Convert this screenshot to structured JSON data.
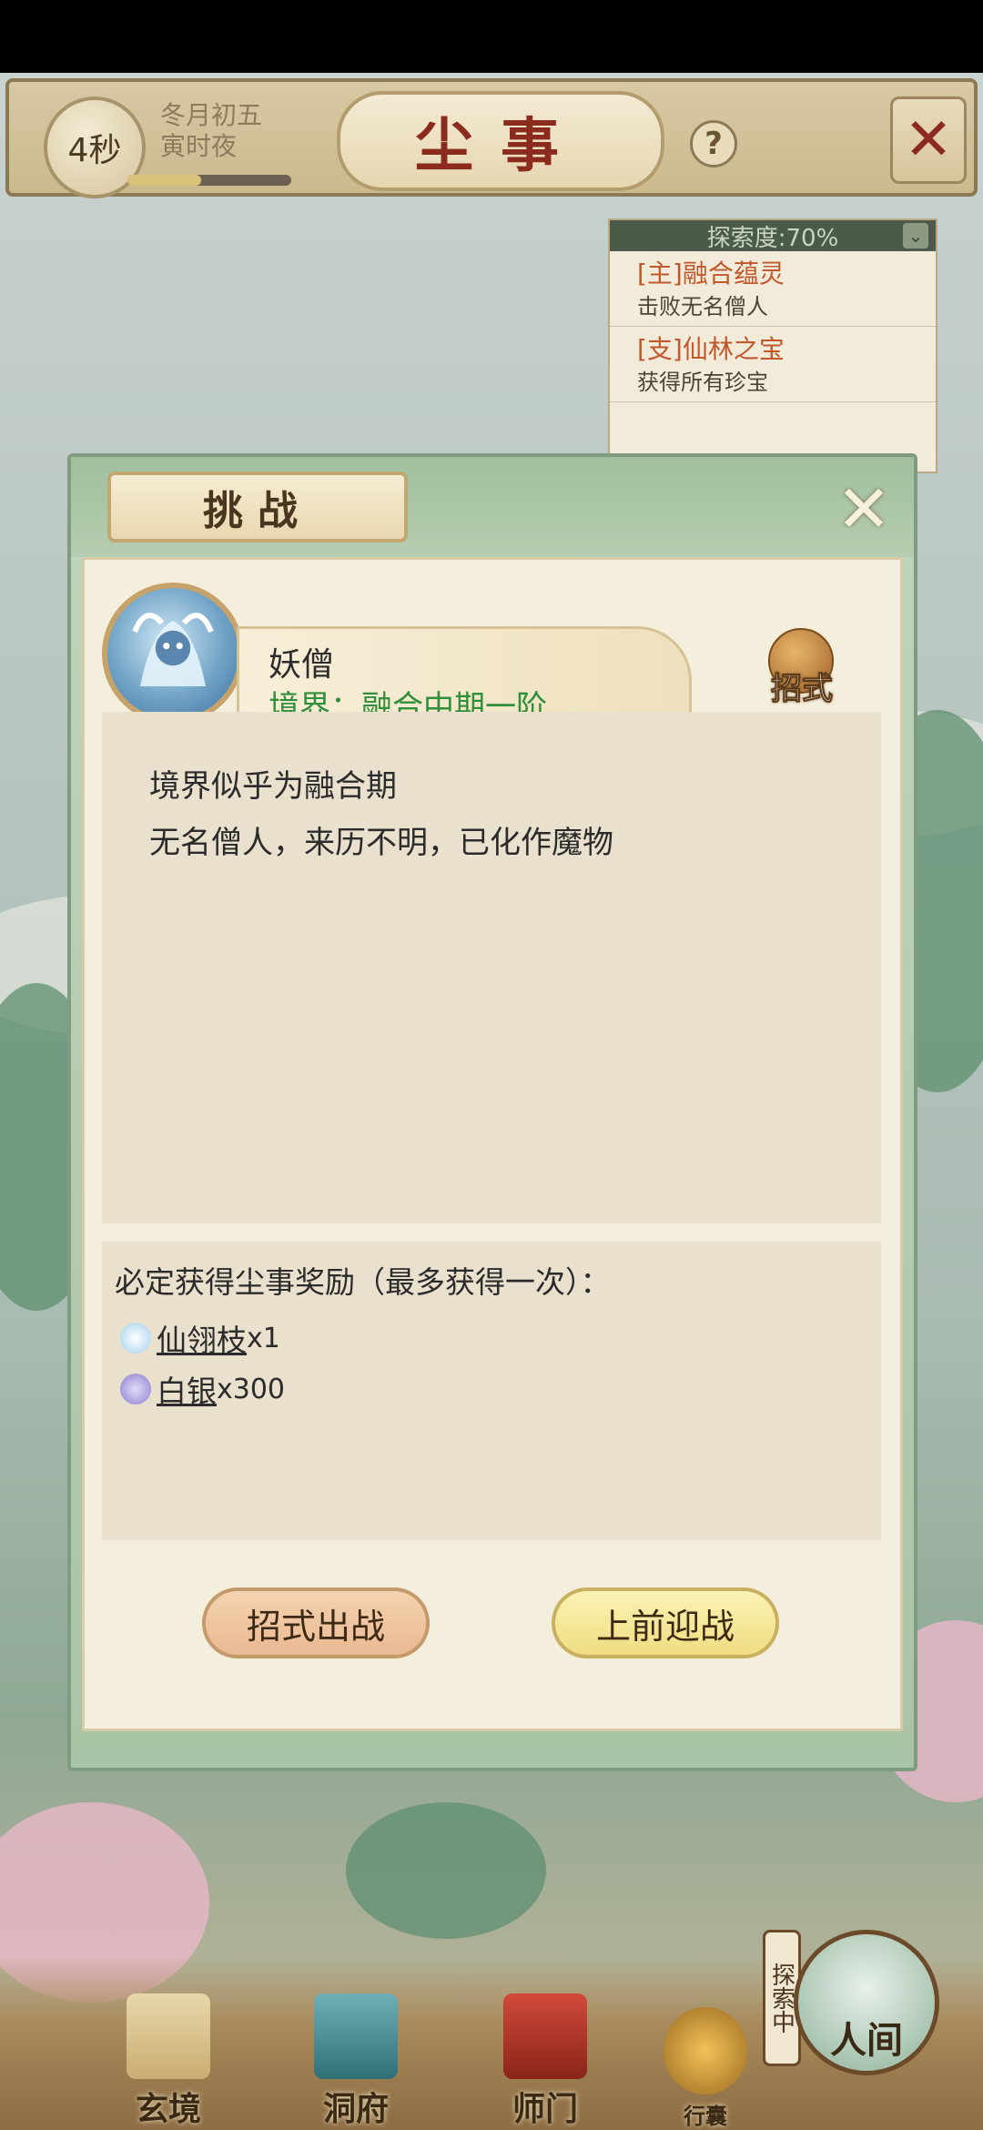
{
  "header": {
    "timer": "4秒",
    "date_line1": "冬月初五",
    "date_line2": "寅时夜",
    "title": "尘事",
    "help_label": "?",
    "close_label": "✕"
  },
  "quest_panel": {
    "progress": "探索度:70%",
    "items": [
      {
        "title": "[主]融合蕴灵",
        "desc": "击败无名僧人"
      },
      {
        "title": "[支]仙林之宝",
        "desc": "获得所有珍宝"
      }
    ]
  },
  "dialog": {
    "title": "挑战",
    "close_label": "✕",
    "enemy": {
      "name": "妖僧",
      "realm": "境界：融合中期一阶"
    },
    "skill_label": "招式",
    "description": [
      "境界似乎为融合期",
      "无名僧人，来历不明，已化作魔物"
    ],
    "reward": {
      "title": "必定获得尘事奖励（最多获得一次）：",
      "items": [
        {
          "name": "仙翎枝",
          "qty": "x1",
          "icon": "feather-icon",
          "color": "#bfe0f2"
        },
        {
          "name": "白银",
          "qty": "x300",
          "icon": "silver-coin-icon",
          "color": "#9a8fd6"
        }
      ]
    },
    "buttons": {
      "skill_fight": "招式出战",
      "face_fight": "上前迎战"
    }
  },
  "bottom_nav": {
    "items": [
      {
        "label": "玄境",
        "icon": "scroll-icon"
      },
      {
        "label": "洞府",
        "icon": "pavilion-icon"
      },
      {
        "label": "师门",
        "icon": "banner-icon"
      },
      {
        "label": "行囊",
        "icon": "bag-icon"
      },
      {
        "label": "人间",
        "icon": "world-icon"
      }
    ],
    "explore_badge": "探索中"
  }
}
